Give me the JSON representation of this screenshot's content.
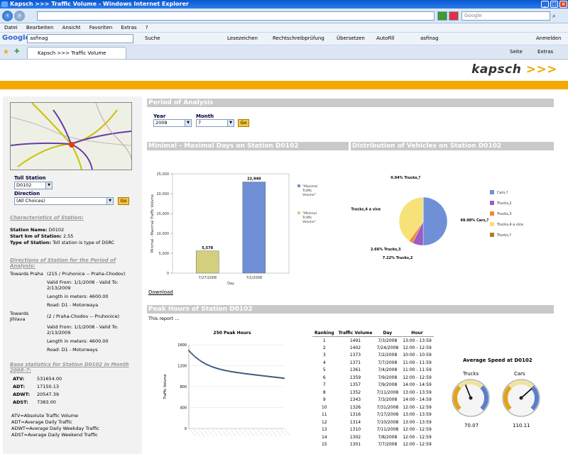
{
  "window": {
    "title": "Kapsch >>> Traffic Volume - Windows Internet Explorer"
  },
  "browser": {
    "search_placeholder": "Google",
    "menu": [
      "Datei",
      "Bearbeiten",
      "Ansicht",
      "Favoriten",
      "Extras",
      "?"
    ],
    "google_label": "Google",
    "google_query": "asfinag",
    "google_buttons": [
      "Suche",
      "Lesezeichen",
      "Rechtschreibprüfung",
      "Übersetzen",
      "AutoFill",
      "asfinag"
    ],
    "anmelden": "Anmelden",
    "tab_title": "Kapsch >>> Traffic Volume",
    "cmd_seite": "Seite",
    "cmd_extras": "Extras"
  },
  "logo": {
    "text": "kapsch",
    "arrows": ">>>"
  },
  "left": {
    "toll_station_label": "Toll Station",
    "toll_station_value": "D0102",
    "direction_label": "Direction",
    "direction_value": "(All Choices)",
    "go": "Go",
    "characteristics_title": "Characteristics of Station:",
    "station_name_label": "Station Name:",
    "station_name": "D0102",
    "start_km_label": "Start km of Station:",
    "start_km": "2.55",
    "type_label": "Type of Station:",
    "type": "Toll station is type of DSRC",
    "directions_title": "Directions of Station for the Period of Analysis:",
    "dir1_name": "Towards Praha",
    "dir1_desc": "(215 / Pruhonice -- Praha-Chodov)",
    "dir1_valid1": "Valid From: 1/1/2008 - Valid To:",
    "dir1_valid2": "2/13/2009",
    "dir1_length": "Length in meters: 4600.00",
    "dir1_road": "Road: D1 - Motorwaya",
    "dir2_name1": "Towards",
    "dir2_name2": "Jihlava",
    "dir2_desc": "(2 / Praha-Chodov -- Pruhonice)",
    "dir2_valid1": "Valid From: 1/1/2008 - Valid To:",
    "dir2_valid2": "2/13/2009",
    "dir2_length": "Length in meters: 4600.00",
    "dir2_road": "Road: D1 - Motorways",
    "base_title": "Base statistics for Station D0102 in Month 2008-7:",
    "stats": [
      {
        "k": "ATV:",
        "v": "531654.00"
      },
      {
        "k": "ADT:",
        "v": "17150.13"
      },
      {
        "k": "ADWT:",
        "v": "20547.39"
      },
      {
        "k": "ADST:",
        "v": "7383.00"
      }
    ],
    "legend": [
      "ATV=Absolute Traffic Volume",
      "ADT=Average Daily Traffic",
      "ADWT=Average Daily Weekday Traffic",
      "ADST=Average Daily Weekend Traffic"
    ]
  },
  "period": {
    "title": "Period of Analysis",
    "year_label": "Year",
    "year_value": "2008",
    "month_label": "Month",
    "month_value": "7",
    "go": "Go"
  },
  "minmax": {
    "title": "Minimal - Maximal Days on Station D0102",
    "download": "Download"
  },
  "dist": {
    "title": "Distribution of Vehicles on Station D0102"
  },
  "peak": {
    "title": "Peak Hours of Station D0102",
    "report_text": "This report ..."
  },
  "ranking": {
    "headers": [
      "Ranking",
      "Traffic Volume",
      "Day",
      "Hour"
    ],
    "rows": [
      [
        "1",
        "1491",
        "7/3/2008",
        "13:00 - 13:59"
      ],
      [
        "2",
        "1402",
        "7/24/2008",
        "12:00 - 12:59"
      ],
      [
        "3",
        "1373",
        "7/2/2008",
        "10:00 - 10:59"
      ],
      [
        "4",
        "1371",
        "7/7/2008",
        "11:00 - 11:59"
      ],
      [
        "5",
        "1361",
        "7/4/2008",
        "11:00 - 11:59"
      ],
      [
        "6",
        "1359",
        "7/9/2008",
        "12:00 - 12:59"
      ],
      [
        "7",
        "1357",
        "7/9/2008",
        "14:00 - 14:59"
      ],
      [
        "8",
        "1352",
        "7/11/2008",
        "13:00 - 13:59"
      ],
      [
        "9",
        "1343",
        "7/3/2008",
        "14:00 - 14:59"
      ],
      [
        "10",
        "1326",
        "7/31/2008",
        "12:00 - 12:59"
      ],
      [
        "11",
        "1316",
        "7/17/2008",
        "13:00 - 13:59"
      ],
      [
        "12",
        "1314",
        "7/10/2008",
        "13:00 - 13:59"
      ],
      [
        "13",
        "1310",
        "7/11/2008",
        "12:00 - 12:59"
      ],
      [
        "14",
        "1302",
        "7/8/2008",
        "12:00 - 12:59"
      ],
      [
        "15",
        "1301",
        "7/7/2008",
        "12:00 - 12:59"
      ]
    ]
  },
  "speed": {
    "title": "Average Speed at D0102",
    "gauges": [
      {
        "name": "Trucks",
        "value": "70.07",
        "fraction": 0.42
      },
      {
        "name": "Cars",
        "value": "110.11",
        "fraction": 0.68
      }
    ]
  },
  "chart_data": [
    {
      "type": "bar",
      "title": "",
      "xlabel": "Day",
      "ylabel": "Minimal - Maximal Traffic Volume",
      "categories": [
        "7/27/2008",
        "7/1/2008"
      ],
      "values": [
        5578,
        22940
      ],
      "data_labels": [
        "5,578",
        "22,940"
      ],
      "ylim": [
        0,
        25000
      ],
      "yticks": [
        "0",
        "5,000",
        "10,000",
        "15,000",
        "20,000",
        "25,000"
      ],
      "colors": [
        "#d4cf7e",
        "#6f8fd6"
      ],
      "legend": [
        "\"Maximal Traffic Volume\"",
        "\"Minimal Traffic Volume\""
      ],
      "legend_placement": "right"
    },
    {
      "type": "pie",
      "slices": [
        {
          "name": "Cars,?",
          "pct": 49.98,
          "label": "49.98%  Cars,?",
          "color": "#6f8fd6"
        },
        {
          "name": "Trucks,2",
          "pct": 7.22,
          "label": "7.22%  Trucks,2",
          "color": "#9a5dc4"
        },
        {
          "name": "Trucks,3",
          "pct": 2.66,
          "label": "2.66%  Trucks,3",
          "color": "#f08a2a"
        },
        {
          "name": "Trucks,4 a vice",
          "pct": 40.1,
          "label": "40.1%  Trucks,4 a vice",
          "color": "#f7e27a"
        },
        {
          "name": "Trucks,?",
          "pct": 0.04,
          "label": "0.04%  Trucks,?",
          "color": "#b07d2a"
        }
      ],
      "legend_placement": "right"
    },
    {
      "type": "line",
      "title": "250 Peak Hours",
      "ylabel": "Traffic Volume",
      "ylim": [
        0,
        1600
      ],
      "yticks": [
        "0",
        "400",
        "800",
        "1200",
        "1600"
      ],
      "points_count": 250,
      "start": 1491,
      "end": 960
    }
  ]
}
